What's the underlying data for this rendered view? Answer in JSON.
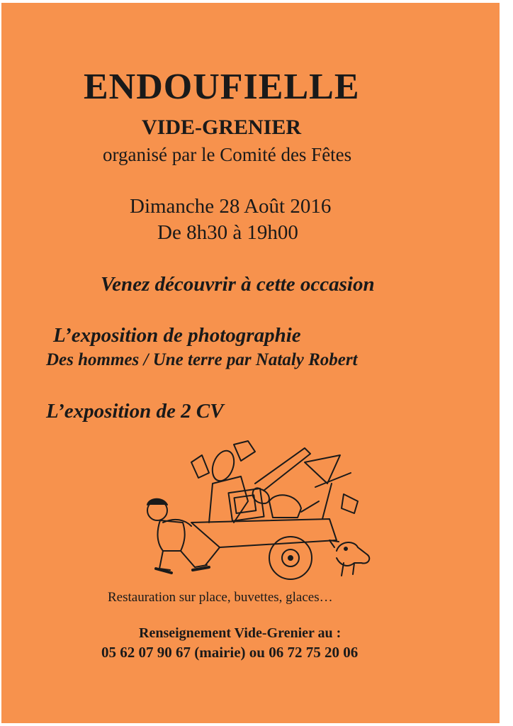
{
  "poster": {
    "title": "ENDOUFIELLE",
    "subtitle": "VIDE-GRENIER",
    "organizer": "organisé par le Comité des Fêtes",
    "date": "Dimanche 28 Août 2016",
    "hours": "De 8h30 à 19h00",
    "invite": "Venez découvrir à cette occasion",
    "exhibition_photo_title": "L’exposition de photographie",
    "exhibition_photo_detail": "Des hommes / Une terre par Nataly Robert",
    "exhibition_cars": "L’exposition de 2 CV",
    "catering": "Restauration sur place, buvettes, glaces…",
    "info_label": "Renseignement Vide-Grenier au :",
    "phones": "05 62 07 90 67 (mairie) ou 06 72 75 20 06"
  },
  "colors": {
    "paper": "#f7924d",
    "ink": "#1a1a1a",
    "margin": "#ffffff"
  },
  "illustration": {
    "icon": "man-pushing-cart-with-dog-illustration"
  }
}
